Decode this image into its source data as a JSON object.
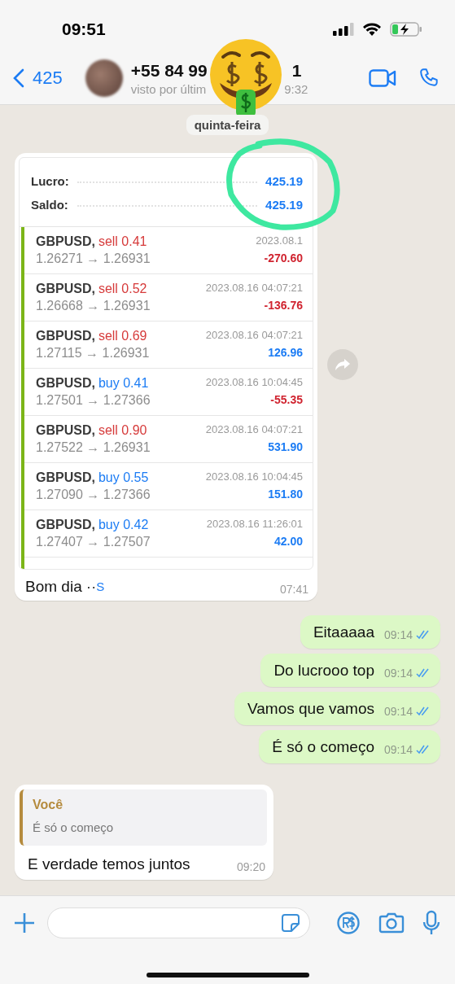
{
  "status_bar": {
    "time": "09:51"
  },
  "header": {
    "back_label": "425",
    "name_parts": [
      "+55 84 99",
      "1"
    ],
    "status_parts": [
      "visto por últim",
      "9:32"
    ]
  },
  "date_chip": "quinta-feira",
  "trade_message": {
    "summary": [
      {
        "label": "Lucro:",
        "value": "425.19"
      },
      {
        "label": "Saldo:",
        "value": "425.19"
      }
    ],
    "trades": [
      {
        "symbol": "GBPUSD,",
        "side": {
          "text": "sell 0.41",
          "color": "#d63a3a"
        },
        "time": "2023.08.1",
        "prices": "1.26271 → 1.26931",
        "result": {
          "text": "-270.60",
          "color": "#d0232f"
        }
      },
      {
        "symbol": "GBPUSD,",
        "side": {
          "text": "sell 0.52",
          "color": "#d63a3a"
        },
        "time": "2023.08.16 04:07:21",
        "prices": "1.26668 → 1.26931",
        "result": {
          "text": "-136.76",
          "color": "#d0232f"
        }
      },
      {
        "symbol": "GBPUSD,",
        "side": {
          "text": "sell 0.69",
          "color": "#d63a3a"
        },
        "time": "2023.08.16 04:07:21",
        "prices": "1.27115 → 1.26931",
        "result": {
          "text": "126.96",
          "color": "#1c7cf4"
        }
      },
      {
        "symbol": "GBPUSD,",
        "side": {
          "text": "buy 0.41",
          "color": "#1c7cf4"
        },
        "time": "2023.08.16 10:04:45",
        "prices": "1.27501 → 1.27366",
        "result": {
          "text": "-55.35",
          "color": "#d0232f"
        }
      },
      {
        "symbol": "GBPUSD,",
        "side": {
          "text": "sell 0.90",
          "color": "#d63a3a"
        },
        "time": "2023.08.16 04:07:21",
        "prices": "1.27522 → 1.26931",
        "result": {
          "text": "531.90",
          "color": "#1c7cf4"
        }
      },
      {
        "symbol": "GBPUSD,",
        "side": {
          "text": "buy 0.55",
          "color": "#1c7cf4"
        },
        "time": "2023.08.16 10:04:45",
        "prices": "1.27090 → 1.27366",
        "result": {
          "text": "151.80",
          "color": "#1c7cf4"
        }
      },
      {
        "symbol": "GBPUSD,",
        "side": {
          "text": "buy 0.42",
          "color": "#1c7cf4"
        },
        "time": "2023.08.16 11:26:01",
        "prices": "1.27407 → 1.27507",
        "result": {
          "text": "42.00",
          "color": "#1c7cf4"
        }
      }
    ],
    "caption": "Bom dia",
    "caption_dots": "··",
    "caption_mark": "S",
    "time": "07:41"
  },
  "outgoing": [
    {
      "text": "Eitaaaaa",
      "time": "09:14",
      "read": true
    },
    {
      "text": "Do lucrooo top",
      "time": "09:14",
      "read": true
    },
    {
      "text": "Vamos que vamos",
      "time": "09:14",
      "read": true
    },
    {
      "text": "É só o começo",
      "time": "09:14",
      "read": true
    }
  ],
  "reply": {
    "quote_author": "Você",
    "quote_text": "É só o começo",
    "text": "E verdade temos juntos",
    "time": "09:20"
  }
}
